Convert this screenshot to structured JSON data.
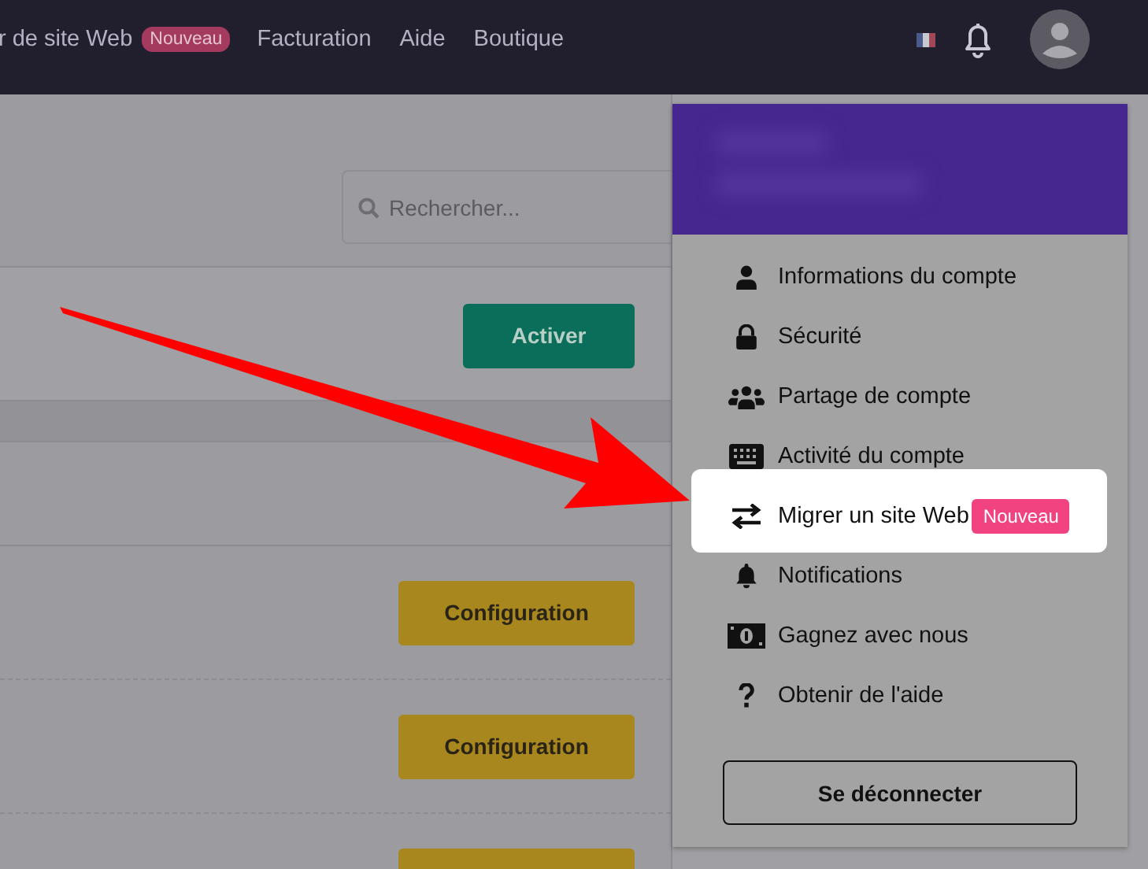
{
  "nav": {
    "items": [
      {
        "label": "r de site Web",
        "badge": "Nouveau"
      },
      {
        "label": "Facturation"
      },
      {
        "label": "Aide"
      },
      {
        "label": "Boutique"
      }
    ]
  },
  "search": {
    "placeholder": "Rechercher..."
  },
  "card": {
    "button": "Activer"
  },
  "rows": [
    {
      "button": "Configuration"
    },
    {
      "button": "Configuration"
    },
    {}
  ],
  "account_menu": {
    "items": [
      {
        "label": "Informations du compte",
        "selected": false
      },
      {
        "label": "Sécurité",
        "selected": false
      },
      {
        "label": "Partage de compte",
        "selected": false
      },
      {
        "label": "Activité du compte",
        "selected": false
      },
      {
        "label": "Migrer un site Web",
        "badge": "Nouveau",
        "selected": true
      },
      {
        "label": "Notifications",
        "selected": false
      },
      {
        "label": "Gagnez avec nous",
        "selected": false
      },
      {
        "label": "Obtenir de l'aide",
        "selected": false
      }
    ],
    "logout": "Se déconnecter"
  }
}
